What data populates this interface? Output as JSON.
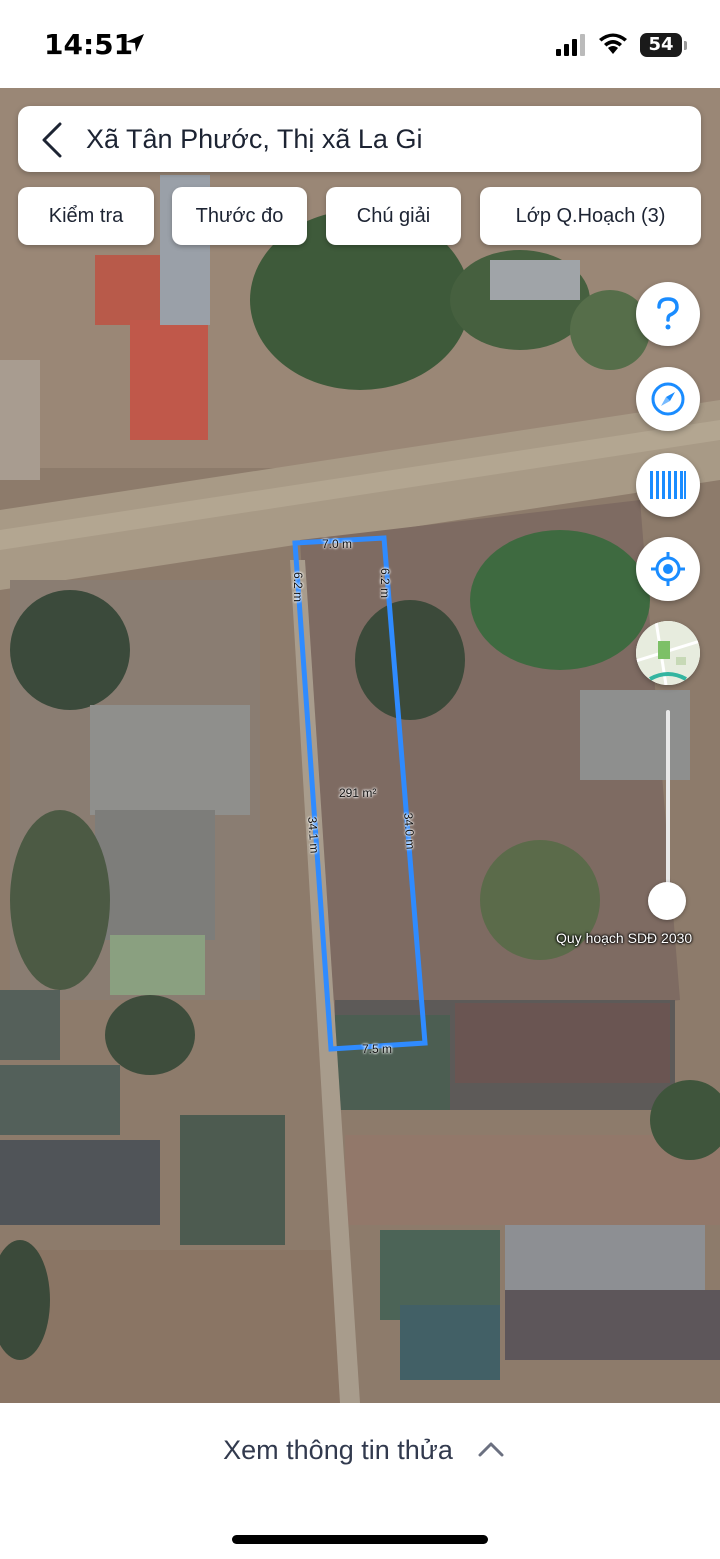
{
  "status": {
    "time": "14:51",
    "battery": "54"
  },
  "search": {
    "location": "Xã Tân Phước, Thị xã La Gi"
  },
  "chips": [
    {
      "label": "Kiểm tra"
    },
    {
      "label": "Thước đo"
    },
    {
      "label": "Chú giải"
    },
    {
      "label": "Lớp Q.Hoạch (3)"
    }
  ],
  "map_controls": {
    "help_icon": "question-mark-icon",
    "compass_icon": "compass-icon",
    "barcode_icon": "barcode-icon",
    "locate_icon": "locate-icon",
    "layer_icon": "map-thumbnail-icon",
    "slider_label": "Quy hoạch SDĐ 2030",
    "slider_value": 0
  },
  "parcel": {
    "top_edge": "7.0 m",
    "left_top_edge": "6.2 m",
    "right_top_edge": "6.2 m",
    "area": "291 m²",
    "left_edge": "34.1 m",
    "right_edge": "34.0 m",
    "bottom_edge": "7.5 m"
  },
  "bottom": {
    "info_label": "Xem thông tin thửa"
  },
  "colors": {
    "parcel_outline": "#2f8bff",
    "accent": "#1a8cff"
  }
}
